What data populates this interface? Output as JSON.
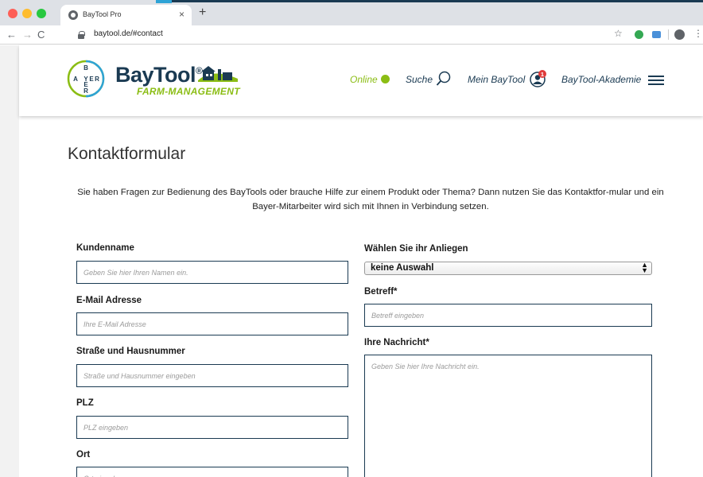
{
  "browser": {
    "tab_title": "BayTool Pro",
    "tab_close": "×",
    "new_tab": "+",
    "url": "baytool.de/#contact",
    "nav_back": "←",
    "nav_forward": "→",
    "nav_reload": "C",
    "bookmark_icon": "☆",
    "menu_icon": "⋮"
  },
  "header": {
    "bayer_letters": [
      "B",
      "A",
      "Y",
      "E",
      "R"
    ],
    "brand_name": "BayTool",
    "brand_tm": "®",
    "brand_subtitle": "FARM-MANAGEMENT",
    "nav": {
      "online": "Online",
      "search": "Suche",
      "mein": "Mein BayTool",
      "akademie": "BayTool-Akademie"
    },
    "notification_count": "1",
    "colors": {
      "navy": "#1a3a52",
      "green": "#8bbd14",
      "bayer_blue": "#2ea3d6"
    }
  },
  "main": {
    "title": "Kontaktformular",
    "intro": "Sie haben Fragen zur Bedienung des BayTools oder brauche Hilfe zur einem Produkt oder Thema? Dann nutzen Sie das Kontaktfor-mular und ein Bayer-Mitarbeiter wird sich mit Ihnen in Verbindung setzen."
  },
  "form": {
    "kundenname": {
      "label": "Kundenname",
      "placeholder": "Geben Sie hier Ihren Namen ein."
    },
    "email": {
      "label": "E-Mail Adresse",
      "placeholder": "Ihre E-Mail Adresse"
    },
    "strasse": {
      "label": "Straße und Hausnummer",
      "placeholder": "Straße und Hausnummer eingeben"
    },
    "plz": {
      "label": "PLZ",
      "placeholder": "PLZ eingeben"
    },
    "ort": {
      "label": "Ort",
      "placeholder": "Ort eingeben"
    },
    "anliegen": {
      "label": "Wählen Sie ihr Anliegen",
      "value": "keine Auswahl"
    },
    "betreff": {
      "label": "Betreff*",
      "placeholder": "Betreff eingeben"
    },
    "nachricht": {
      "label": "Ihre Nachricht*",
      "placeholder": "Geben Sie hier Ihre Nachricht ein."
    }
  }
}
